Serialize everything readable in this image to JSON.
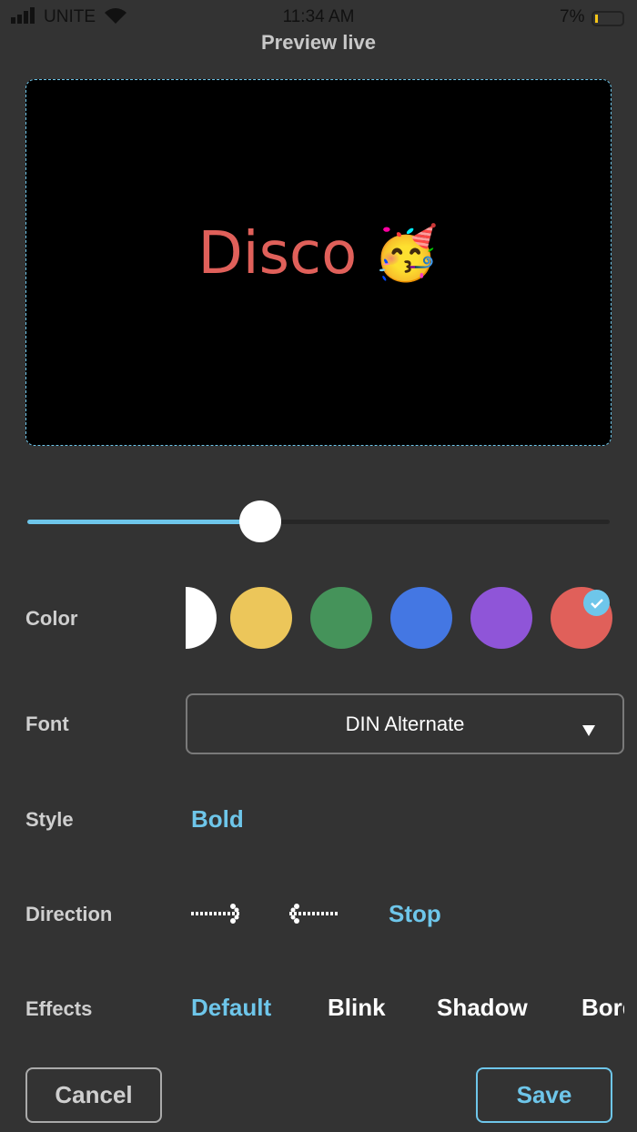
{
  "status_bar": {
    "carrier": "UNITE",
    "time": "11:34 AM",
    "battery": "7%"
  },
  "header": {
    "title": "Preview live"
  },
  "preview": {
    "text": "Disco",
    "emoji": "🥳",
    "text_color": "#e0605a"
  },
  "slider": {
    "value_fraction": 0.4
  },
  "color": {
    "label": "Color",
    "swatches": [
      "#ffffff",
      "#ecc65a",
      "#45935a",
      "#4477e3",
      "#8f55d8",
      "#e0605a"
    ],
    "selected": 5
  },
  "font": {
    "label": "Font",
    "value": "DIN Alternate"
  },
  "style": {
    "label": "Style",
    "value": "Bold"
  },
  "direction": {
    "label": "Direction",
    "stop": "Stop"
  },
  "effects": {
    "label": "Effects",
    "options": [
      "Default",
      "Blink",
      "Shadow",
      "Border"
    ]
  },
  "buttons": {
    "cancel": "Cancel",
    "save": "Save"
  },
  "accent": "#6ec6ea"
}
